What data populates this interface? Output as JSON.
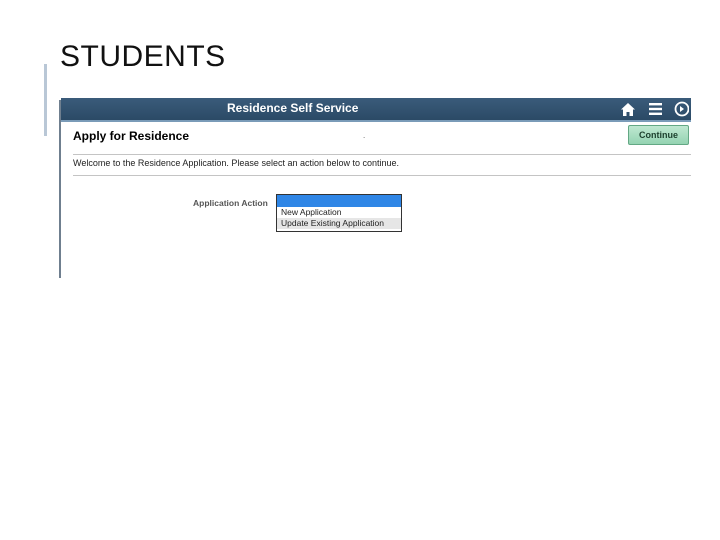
{
  "slide": {
    "title": "STUDENTS"
  },
  "app": {
    "banner_title": "Residence Self Service",
    "icons": [
      "home-icon",
      "menu-icon",
      "navigation-icon"
    ],
    "page_title": "Apply for Residence",
    "separator_dot": ".",
    "continue_label": "Continue",
    "welcome_text": "Welcome to the Residence Application. Please select an action below to continue.",
    "action_label": "Application Action",
    "action_options": [
      "",
      "New Application",
      "Update Existing Application"
    ],
    "colors": {
      "banner": "#2f4f6d",
      "continue": "#a7dcc0",
      "selected": "#2f86e6"
    }
  }
}
